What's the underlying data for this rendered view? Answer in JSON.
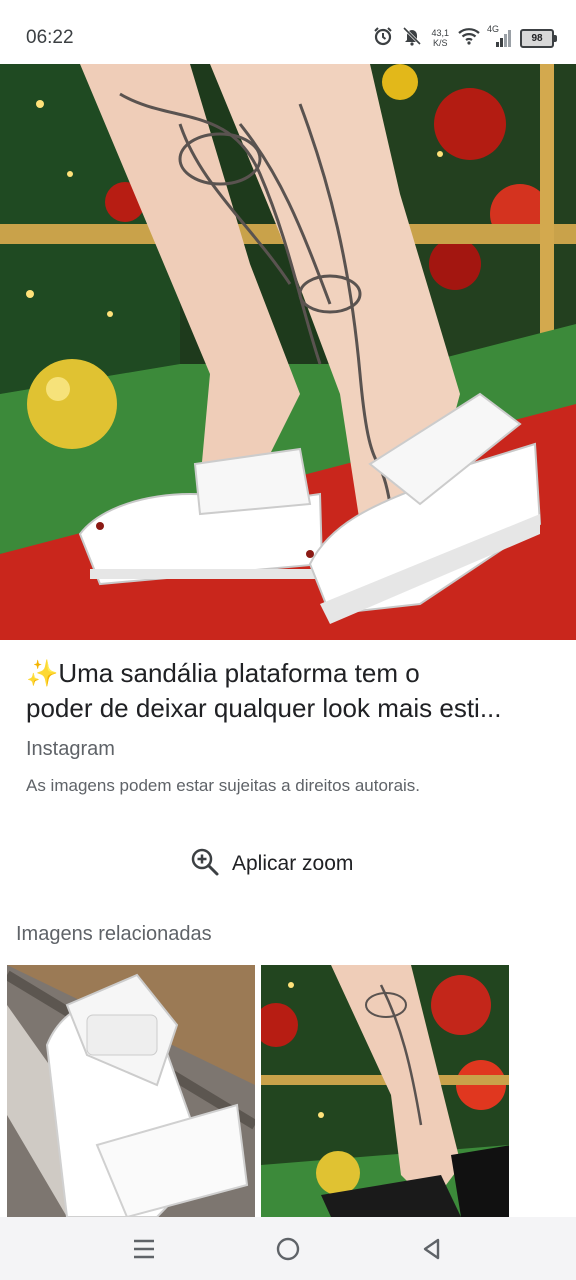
{
  "status_bar": {
    "time": "06:22",
    "net_speed_value": "43,1",
    "net_speed_unit": "K/S",
    "network_type": "4G",
    "battery": "98",
    "icons": [
      "alarm-icon",
      "mute-bell-icon",
      "wifi-icon",
      "signal-icon",
      "battery-icon"
    ]
  },
  "image_detail": {
    "hero_image": "white-platform-sandals-photo",
    "caption_line1": "✨Uma sandália plataforma tem o",
    "caption_line2": "poder de deixar qualquer look mais esti...",
    "source": "Instagram",
    "copyright_notice": "As imagens podem estar sujeitas a direitos autorais."
  },
  "zoom": {
    "label": "Aplicar zoom",
    "icon": "zoom-in-icon"
  },
  "related": {
    "title": "Imagens relacionadas",
    "items": [
      {
        "image": "white-sandal-closeup"
      },
      {
        "image": "black-sandals-christmas-tree"
      }
    ]
  },
  "nav_bar": {
    "icons": [
      "menu-icon",
      "home-icon",
      "back-icon"
    ]
  },
  "colors": {
    "text_primary": "#202124",
    "text_secondary": "#5f6368",
    "nav_background": "#f4f4f6",
    "carpet_red": "#c9261c",
    "floor_green": "#3c8a3a"
  }
}
